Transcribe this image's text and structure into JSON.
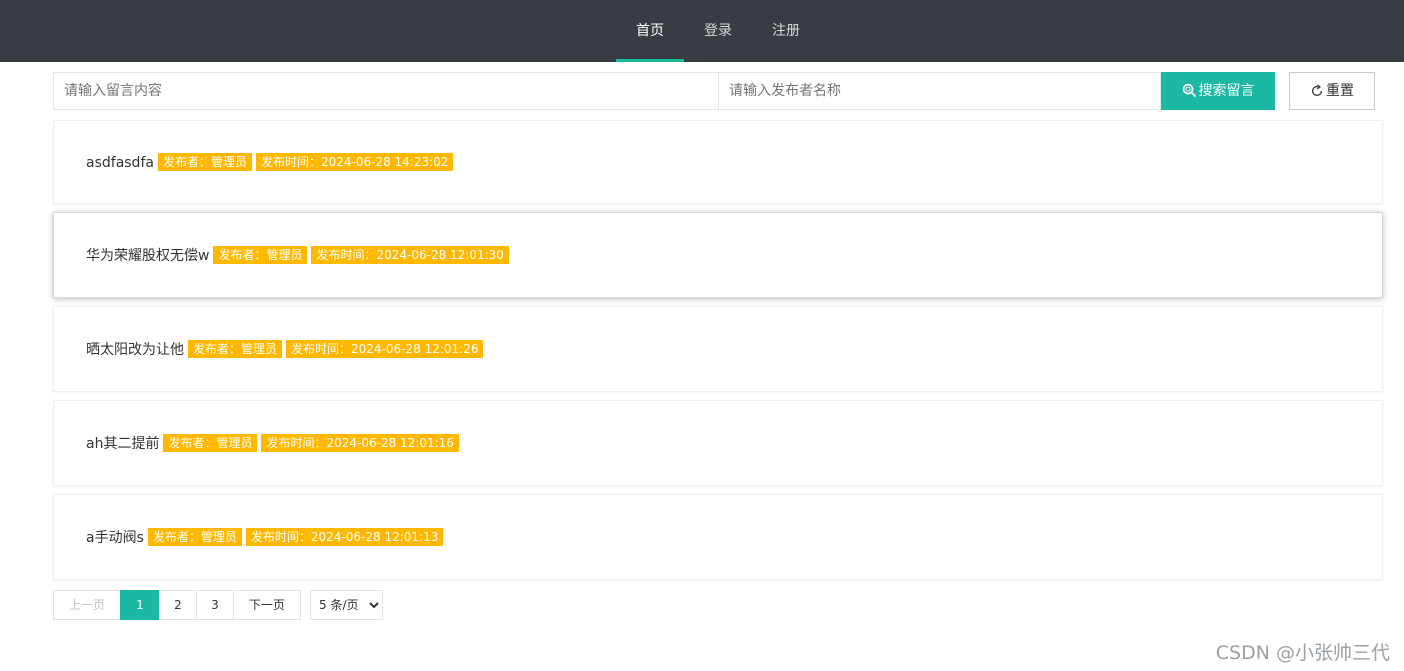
{
  "nav": {
    "items": [
      {
        "label": "首页",
        "active": true
      },
      {
        "label": "登录",
        "active": false
      },
      {
        "label": "注册",
        "active": false
      }
    ],
    "active_color": "#1bbc9b",
    "background": "#393d43"
  },
  "search": {
    "content_placeholder": "请输入留言内容",
    "content_value": "",
    "publisher_placeholder": "请输入发布者名称",
    "publisher_value": "",
    "search_button_label": "搜索留言",
    "search_icon": "search-icon",
    "reset_button_label": "重置",
    "reset_icon": "refresh-icon"
  },
  "messages": [
    {
      "content": "asdfasdfa",
      "publisher": "发布者：管理员",
      "time": "发布时间：2024-06-28 14:23:02"
    },
    {
      "content": "华为荣耀股权无偿w",
      "publisher": "发布者：管理员",
      "time": "发布时间：2024-06-28 12:01:30"
    },
    {
      "content": "晒太阳改为让他",
      "publisher": "发布者：管理员",
      "time": "发布时间：2024-06-28 12:01:26"
    },
    {
      "content": "ah其二提前",
      "publisher": "发布者：管理员",
      "time": "发布时间：2024-06-28 12:01:16"
    },
    {
      "content": "a手动阀s",
      "publisher": "发布者：管理员",
      "time": "发布时间：2024-06-28 12:01:13"
    }
  ],
  "badge_color": "#ffb800",
  "pagination": {
    "prev_label": "上一页",
    "pages": [
      "1",
      "2",
      "3"
    ],
    "current_page": "1",
    "next_label": "下一页",
    "limit_selected": "5 条/页"
  },
  "watermark": "CSDN @小张帅三代"
}
